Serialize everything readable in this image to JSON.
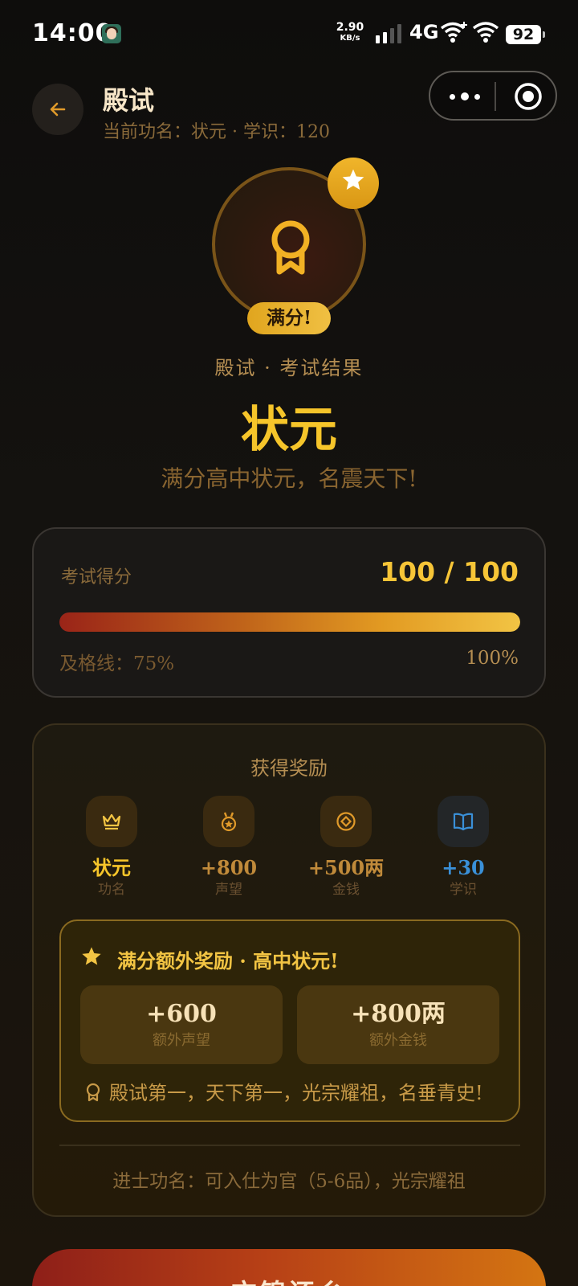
{
  "status_bar": {
    "time": "14:00",
    "net_speed_value": "2.90",
    "net_speed_unit": "KB/s",
    "network_type": "4G",
    "battery": "92"
  },
  "header": {
    "title": "殿试",
    "subtitle": "当前功名：状元 · 学识：120"
  },
  "result": {
    "badge": "满分!",
    "caption": "殿试 · 考试结果",
    "rank": "状元",
    "description": "满分高中状元，名震天下!"
  },
  "score": {
    "label": "考试得分",
    "value": "100 / 100",
    "progress_fraction": 1.0,
    "pass_line": "及格线：75%",
    "max_label": "100%"
  },
  "rewards": {
    "heading": "获得奖励",
    "items": [
      {
        "icon": "crown-icon",
        "value": "状元",
        "label": "功名"
      },
      {
        "icon": "medal-icon",
        "value": "+800",
        "label": "声望"
      },
      {
        "icon": "coin-icon",
        "value": "+500两",
        "label": "金钱"
      },
      {
        "icon": "book-icon",
        "value": "+30",
        "label": "学识"
      }
    ],
    "bonus": {
      "title": "满分额外奖励 · 高中状元!",
      "tiles": [
        {
          "value": "+600",
          "label": "额外声望"
        },
        {
          "value": "+800两",
          "label": "额外金钱"
        }
      ],
      "quote": "殿试第一，天下第一，光宗耀祖，名垂青史!"
    },
    "rank_note": "进士功名：可入仕为官（5-6品），光宗耀祖"
  },
  "action": {
    "label": "衣锦还乡"
  },
  "colors": {
    "accent_gold": "#f6c52a",
    "accent_blue": "#3a90d8",
    "button_red": "#8e1f18",
    "button_orange": "#d47512"
  }
}
